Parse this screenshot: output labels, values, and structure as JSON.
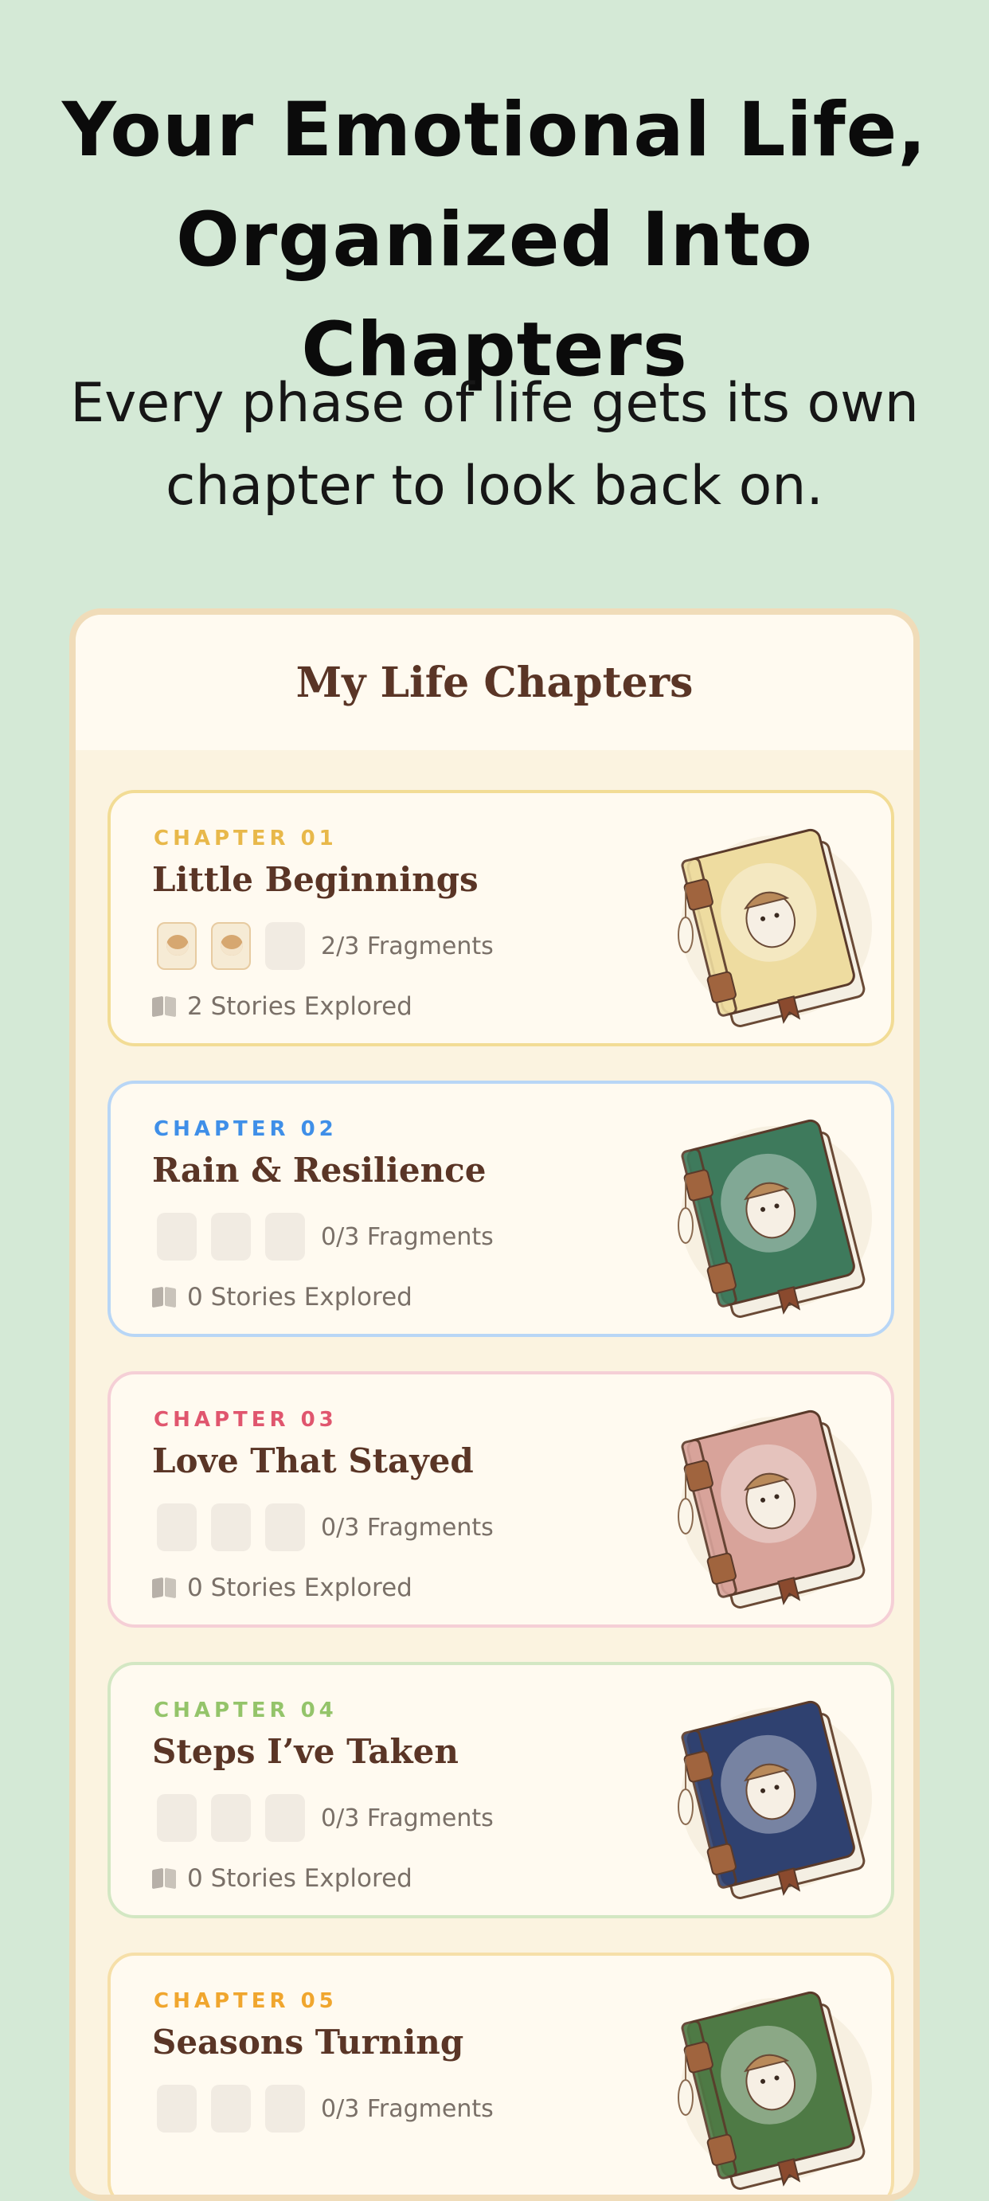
{
  "headline": {
    "line1": "Your Emotional Life,",
    "line2": "Organized Into Chapters"
  },
  "subhead": {
    "line1": "Every phase of life gets its own",
    "line2": "chapter to look back on."
  },
  "screen": {
    "title": "My Life Chapters",
    "chapters": [
      {
        "label": "CHAPTER 01",
        "title": "Little Beginnings",
        "fragments": "2/3 Fragments",
        "fragments_filled": 2,
        "stories": "2 Stories Explored",
        "accent": "#e8b84a",
        "border": "#f2dc95",
        "book_color": "#eedca0",
        "illustration": "hedgehog-explorer-book-icon"
      },
      {
        "label": "CHAPTER 02",
        "title": "Rain & Resilience",
        "fragments": "0/3 Fragments",
        "fragments_filled": 0,
        "stories": "0 Stories Explored",
        "accent": "#3f8fe8",
        "border": "#b8d6f6",
        "book_color": "#3e7a5c",
        "illustration": "hedgehog-umbrella-book-icon"
      },
      {
        "label": "CHAPTER 03",
        "title": "Love That Stayed",
        "fragments": "0/3 Fragments",
        "fragments_filled": 0,
        "stories": "0 Stories Explored",
        "accent": "#e0566e",
        "border": "#f5cfd6",
        "book_color": "#d8a39a",
        "illustration": "hedgehog-petals-book-icon"
      },
      {
        "label": "CHAPTER 04",
        "title": "Steps I’ve Taken",
        "fragments": "0/3 Fragments",
        "fragments_filled": 0,
        "stories": "0 Stories Explored",
        "accent": "#94c46a",
        "border": "#d3e7c3",
        "book_color": "#2f4170",
        "illustration": "hedgehog-forest-book-icon"
      },
      {
        "label": "CHAPTER 05",
        "title": "Seasons Turning",
        "fragments": "0/3 Fragments",
        "fragments_filled": 0,
        "stories": "",
        "accent": "#f0a62e",
        "border": "#f6dfa8",
        "book_color": "#4e7a45",
        "illustration": "hedgehog-autumn-book-icon"
      }
    ]
  }
}
